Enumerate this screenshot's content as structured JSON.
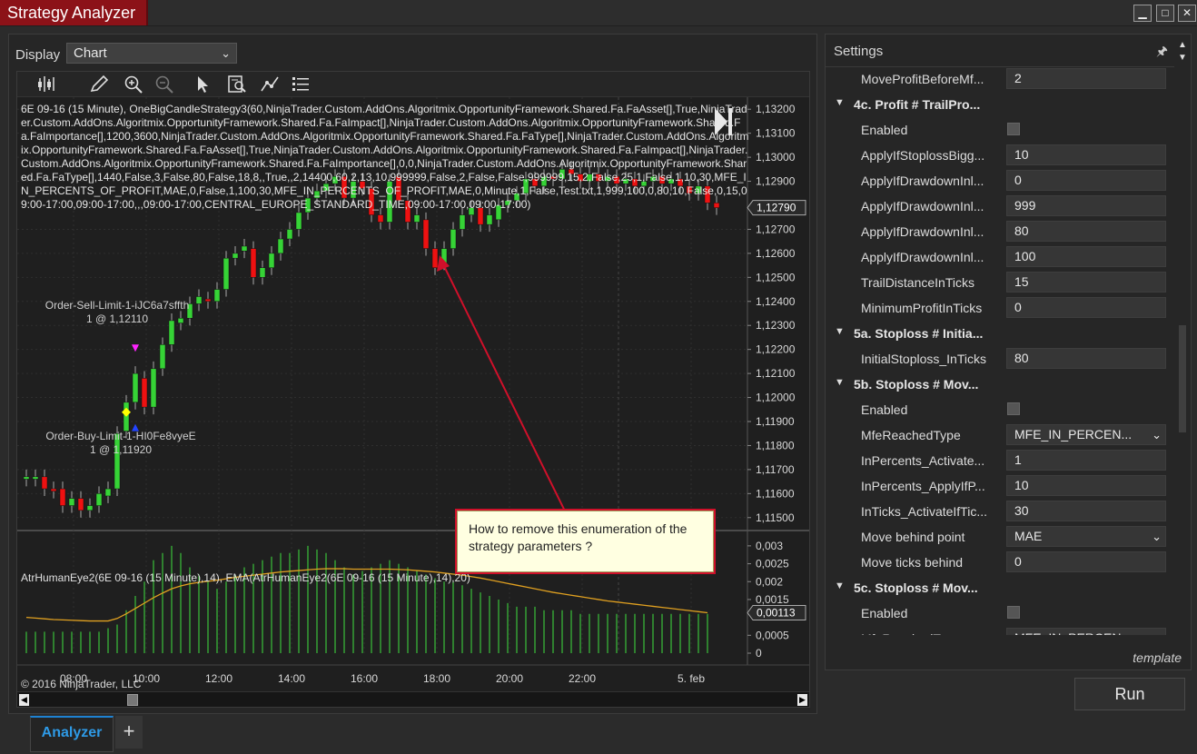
{
  "window": {
    "title": "Strategy Analyzer",
    "buttons": [
      "minimize",
      "maximize",
      "close"
    ]
  },
  "display": {
    "label": "Display",
    "selected": "Chart"
  },
  "toolbar": {
    "icons": [
      "bar-type-icon",
      "drawing-tool-icon",
      "zoom-in-icon",
      "zoom-out-icon",
      "pointer-icon",
      "data-box-icon",
      "indicators-icon",
      "properties-icon"
    ]
  },
  "chart": {
    "description": "6E 09-16 (15 Minute), OneBigCandleStrategy3(60,NinjaTrader.Custom.AddOns.Algoritmix.OpportunityFramework.Shared.Fa.FaAsset[],True,NinjaTrader.Custom.AddOns.Algoritmix.OpportunityFramework.Shared.Fa.FaImpact[],NinjaTrader.Custom.AddOns.Algoritmix.OpportunityFramework.Shared.Fa.FaImportance[],1200,3600,NinjaTrader.Custom.AddOns.Algoritmix.OpportunityFramework.Shared.Fa.FaType[],NinjaTrader.Custom.AddOns.Algoritmix.OpportunityFramework.Shared.Fa.FaAsset[],True,NinjaTrader.Custom.AddOns.Algoritmix.OpportunityFramework.Shared.Fa.FaImpact[],NinjaTrader.Custom.AddOns.Algoritmix.OpportunityFramework.Shared.Fa.FaImportance[],0,0,NinjaTrader.Custom.AddOns.Algoritmix.OpportunityFramework.Shared.Fa.FaType[],1440,False,3,False,80,False,18,8,,True,,2,14400,60,2,13,10,999999,False,2,False,False,999999,15,2,False,25,1,False,1,10,30,MFE_IN_PERCENTS_OF_PROFIT,MAE,0,False,1,100,30,MFE_IN_PERCENTS_OF_PROFIT,MAE,0,Minute,1,False,Test.txt,1,999,100,0,80,10,False,0,15,09:00-17:00,09:00-17:00,,,09:00-17:00,CENTRAL_EUROPE_STANDARD_TIME,09:00-17:00,09:00-17:00)",
    "indicator_title": "AtrHumanEye2(6E 09-16 (15 Minute),14), EMA(AtrHumanEye2(6E 09-16 (15 Minute),14),20)",
    "copyright": "© 2016 NinjaTrader, LLC",
    "sell_order_label": [
      "Order-Sell-Limit-1-iJC6a7sffth",
      "1 @ 1,12110"
    ],
    "buy_order_label": [
      "Order-Buy-Limit-1-HI0Fe8vyeE",
      "1 @ 1,11920"
    ],
    "price_axis": [
      "1,13200",
      "1,13100",
      "1,13000",
      "1,12900",
      "1,12700",
      "1,12600",
      "1,12500",
      "1,12400",
      "1,12300",
      "1,12200",
      "1,12100",
      "1,12000",
      "1,11900",
      "1,11800",
      "1,11700",
      "1,11600",
      "1,11500"
    ],
    "price_axis_values": [
      1.132,
      1.131,
      1.13,
      1.129,
      1.127,
      1.126,
      1.125,
      1.124,
      1.123,
      1.122,
      1.121,
      1.12,
      1.119,
      1.118,
      1.117,
      1.116,
      1.115
    ],
    "last_price_label": "1,12790",
    "last_price": 1.1279,
    "indicator_axis": [
      "0,003",
      "0,0025",
      "0,002",
      "0,0015",
      "0,0005",
      "0"
    ],
    "indicator_axis_values": [
      0.003,
      0.0025,
      0.002,
      0.0015,
      0.0005,
      0
    ],
    "last_indicator_label": "0,00113",
    "last_indicator": 0.00113,
    "time_axis": [
      "08:00",
      "10:00",
      "12:00",
      "14:00",
      "16:00",
      "18:00",
      "20:00",
      "22:00",
      "5. feb"
    ],
    "callout_text": "How to remove this enumeration of the strategy parameters ?"
  },
  "chart_data": {
    "type": "candlestick",
    "instrument": "6E 09-16 (15 Minute)",
    "x_ticks": [
      "08:00",
      "10:00",
      "12:00",
      "14:00",
      "16:00",
      "18:00",
      "20:00",
      "22:00",
      "5. feb"
    ],
    "price_range": [
      1.1145,
      1.1325
    ],
    "candles": [
      {
        "o": 1.1166,
        "c": 1.1167
      },
      {
        "o": 1.1166,
        "c": 1.1167
      },
      {
        "o": 1.1167,
        "c": 1.1162
      },
      {
        "o": 1.1162,
        "c": 1.1161
      },
      {
        "o": 1.1162,
        "c": 1.1155
      },
      {
        "o": 1.1155,
        "c": 1.1158
      },
      {
        "o": 1.1158,
        "c": 1.1153
      },
      {
        "o": 1.1153,
        "c": 1.1155
      },
      {
        "o": 1.1155,
        "c": 1.116
      },
      {
        "o": 1.1159,
        "c": 1.1162
      },
      {
        "o": 1.1162,
        "c": 1.1185
      },
      {
        "o": 1.1186,
        "c": 1.1198
      },
      {
        "o": 1.1198,
        "c": 1.121
      },
      {
        "o": 1.1208,
        "c": 1.1196
      },
      {
        "o": 1.1196,
        "c": 1.1212
      },
      {
        "o": 1.1212,
        "c": 1.1222
      },
      {
        "o": 1.1222,
        "c": 1.1232
      },
      {
        "o": 1.1231,
        "c": 1.1233
      },
      {
        "o": 1.1233,
        "c": 1.1239
      },
      {
        "o": 1.1239,
        "c": 1.1242
      },
      {
        "o": 1.1241,
        "c": 1.124
      },
      {
        "o": 1.124,
        "c": 1.1245
      },
      {
        "o": 1.1245,
        "c": 1.1258
      },
      {
        "o": 1.1258,
        "c": 1.126
      },
      {
        "o": 1.1261,
        "c": 1.1263
      },
      {
        "o": 1.1262,
        "c": 1.125
      },
      {
        "o": 1.125,
        "c": 1.1254
      },
      {
        "o": 1.1254,
        "c": 1.126
      },
      {
        "o": 1.126,
        "c": 1.1266
      },
      {
        "o": 1.1266,
        "c": 1.127
      },
      {
        "o": 1.127,
        "c": 1.1277
      },
      {
        "o": 1.1277,
        "c": 1.1283
      },
      {
        "o": 1.1283,
        "c": 1.1286
      },
      {
        "o": 1.1286,
        "c": 1.1289
      },
      {
        "o": 1.1289,
        "c": 1.1292
      },
      {
        "o": 1.1292,
        "c": 1.1283
      },
      {
        "o": 1.1283,
        "c": 1.129
      },
      {
        "o": 1.129,
        "c": 1.1287
      },
      {
        "o": 1.1287,
        "c": 1.1276
      },
      {
        "o": 1.1276,
        "c": 1.1273
      },
      {
        "o": 1.1273,
        "c": 1.129
      },
      {
        "o": 1.1292,
        "c": 1.1282
      },
      {
        "o": 1.1282,
        "c": 1.1273
      },
      {
        "o": 1.1273,
        "c": 1.1276
      },
      {
        "o": 1.1274,
        "c": 1.1262
      },
      {
        "o": 1.1262,
        "c": 1.1254
      },
      {
        "o": 1.1256,
        "c": 1.1262
      },
      {
        "o": 1.1262,
        "c": 1.127
      },
      {
        "o": 1.127,
        "c": 1.1276
      },
      {
        "o": 1.1276,
        "c": 1.1279
      },
      {
        "o": 1.1279,
        "c": 1.1272
      },
      {
        "o": 1.1272,
        "c": 1.1276
      },
      {
        "o": 1.1274,
        "c": 1.128
      },
      {
        "o": 1.128,
        "c": 1.1282
      },
      {
        "o": 1.1282,
        "c": 1.1285
      },
      {
        "o": 1.1285,
        "c": 1.1291
      },
      {
        "o": 1.1291,
        "c": 1.1288
      },
      {
        "o": 1.1288,
        "c": 1.1292
      },
      {
        "o": 1.1292,
        "c": 1.1291
      },
      {
        "o": 1.1291,
        "c": 1.1295
      },
      {
        "o": 1.1295,
        "c": 1.1293
      },
      {
        "o": 1.1293,
        "c": 1.129
      },
      {
        "o": 1.129,
        "c": 1.1293
      },
      {
        "o": 1.1293,
        "c": 1.129
      },
      {
        "o": 1.129,
        "c": 1.1292
      },
      {
        "o": 1.1292,
        "c": 1.1289
      },
      {
        "o": 1.1289,
        "c": 1.1291
      },
      {
        "o": 1.1291,
        "c": 1.1288
      },
      {
        "o": 1.1288,
        "c": 1.129
      },
      {
        "o": 1.129,
        "c": 1.1292
      },
      {
        "o": 1.1292,
        "c": 1.1289
      },
      {
        "o": 1.1289,
        "c": 1.1291
      },
      {
        "o": 1.1291,
        "c": 1.1288
      },
      {
        "o": 1.1288,
        "c": 1.1285
      },
      {
        "o": 1.1285,
        "c": 1.1288
      },
      {
        "o": 1.1288,
        "c": 1.1281
      },
      {
        "o": 1.1281,
        "c": 1.1279
      }
    ],
    "indicator": {
      "name": "AtrHumanEye2 / EMA",
      "range": [
        0,
        0.0032
      ],
      "bars": [
        0.0006,
        0.0006,
        0.0006,
        0.0006,
        0.0006,
        0.0006,
        0.0006,
        0.0006,
        0.0006,
        0.0007,
        0.0008,
        0.0012,
        0.0016,
        0.002,
        0.0026,
        0.0028,
        0.003,
        0.0028,
        0.0024,
        0.0022,
        0.002,
        0.0018,
        0.002,
        0.0022,
        0.0024,
        0.0025,
        0.0026,
        0.0027,
        0.0028,
        0.0028,
        0.0029,
        0.003,
        0.0029,
        0.0028,
        0.0026,
        0.0024,
        0.0022,
        0.0023,
        0.0024,
        0.0025,
        0.0026,
        0.0025,
        0.0024,
        0.0023,
        0.0022,
        0.0021,
        0.002,
        0.002,
        0.0019,
        0.0018,
        0.0017,
        0.0016,
        0.0015,
        0.0014,
        0.0013,
        0.0013,
        0.0013,
        0.0012,
        0.0012,
        0.0012,
        0.0012,
        0.0011,
        0.0011,
        0.0011,
        0.0011,
        0.0011,
        0.0011,
        0.0011,
        0.0011,
        0.0011,
        0.0011,
        0.0011,
        0.0011,
        0.0011,
        0.0011,
        0.0011
      ],
      "ema": [
        0.001,
        0.00098,
        0.00096,
        0.00094,
        0.00093,
        0.00092,
        0.00091,
        0.0009,
        0.0009,
        0.0009,
        0.00097,
        0.0011,
        0.00125,
        0.0014,
        0.00155,
        0.00168,
        0.0018,
        0.00188,
        0.00194,
        0.00198,
        0.00201,
        0.00204,
        0.00208,
        0.00212,
        0.00215,
        0.00218,
        0.00221,
        0.00224,
        0.00227,
        0.00229,
        0.00231,
        0.00233,
        0.00235,
        0.00236,
        0.00236,
        0.00236,
        0.00235,
        0.00235,
        0.00235,
        0.00235,
        0.00235,
        0.00234,
        0.00233,
        0.00231,
        0.00229,
        0.00227,
        0.00224,
        0.00221,
        0.00218,
        0.00214,
        0.0021,
        0.00205,
        0.002,
        0.00195,
        0.0019,
        0.00185,
        0.0018,
        0.00175,
        0.0017,
        0.00166,
        0.00162,
        0.00158,
        0.00154,
        0.0015,
        0.00146,
        0.00143,
        0.0014,
        0.00137,
        0.00134,
        0.00131,
        0.00128,
        0.00125,
        0.00122,
        0.00119,
        0.00116,
        0.00113
      ]
    }
  },
  "settings": {
    "title": "Settings",
    "rows": [
      {
        "kind": "prop",
        "name": "MoveProfitBeforeMf...",
        "value": "2"
      },
      {
        "kind": "cat",
        "name": "4c. Profit # TrailPro..."
      },
      {
        "kind": "check",
        "name": "Enabled"
      },
      {
        "kind": "prop",
        "name": "ApplyIfStoplossBigg...",
        "value": "10"
      },
      {
        "kind": "prop",
        "name": "ApplyIfDrawdownInl...",
        "value": "0"
      },
      {
        "kind": "prop",
        "name": "ApplyIfDrawdownInl...",
        "value": "999"
      },
      {
        "kind": "prop",
        "name": "ApplyIfDrawdownInl...",
        "value": "80"
      },
      {
        "kind": "prop",
        "name": "ApplyIfDrawdownInl...",
        "value": "100"
      },
      {
        "kind": "prop",
        "name": "TrailDistanceInTicks",
        "value": "15"
      },
      {
        "kind": "prop",
        "name": "MinimumProfitInTicks",
        "value": "0"
      },
      {
        "kind": "cat",
        "name": "5a. Stoploss # Initia..."
      },
      {
        "kind": "prop",
        "name": "InitialStoploss_InTicks",
        "value": "80"
      },
      {
        "kind": "cat",
        "name": "5b. Stoploss # Mov..."
      },
      {
        "kind": "check",
        "name": "Enabled"
      },
      {
        "kind": "select",
        "name": "MfeReachedType",
        "value": "MFE_IN_PERCEN..."
      },
      {
        "kind": "prop",
        "name": "InPercents_Activate...",
        "value": "1"
      },
      {
        "kind": "prop",
        "name": "InPercents_ApplyIfP...",
        "value": "10"
      },
      {
        "kind": "prop",
        "name": "InTicks_ActivateIfTic...",
        "value": "30"
      },
      {
        "kind": "select",
        "name": "Move behind point",
        "value": "MAE"
      },
      {
        "kind": "prop",
        "name": "Move ticks behind",
        "value": "0"
      },
      {
        "kind": "cat",
        "name": "5c. Stoploss # Mov..."
      },
      {
        "kind": "check",
        "name": "Enabled"
      },
      {
        "kind": "select",
        "name": "MfeReachedType",
        "value": "MFE_IN_PERCEN..."
      }
    ],
    "template_label": "template",
    "run_label": "Run"
  },
  "tabs": {
    "active": "Analyzer",
    "add": "+"
  }
}
